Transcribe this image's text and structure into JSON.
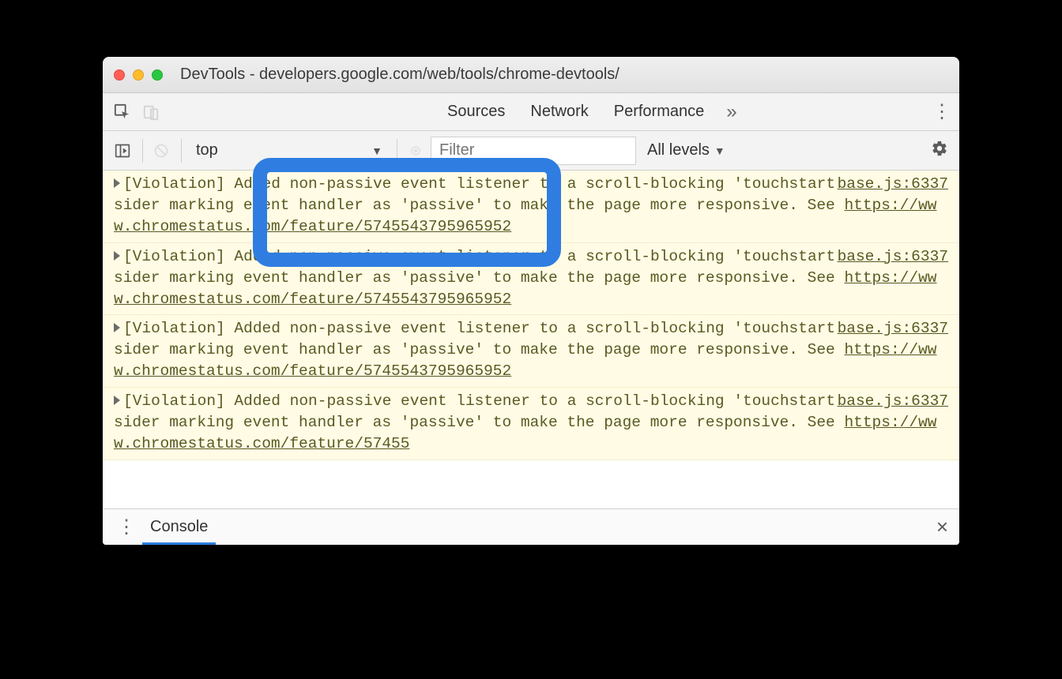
{
  "window": {
    "title": "DevTools - developers.google.com/web/tools/chrome-devtools/"
  },
  "tabs": {
    "sources": "Sources",
    "network": "Network",
    "performance": "Performance",
    "more": "»"
  },
  "subbar": {
    "context": "top",
    "filter_placeholder": "Filter",
    "levels": "All levels"
  },
  "log": {
    "source": "base.js:6337",
    "entries": [
      {
        "prefix": "[Violation] Added non-passive event listener to a scroll-blocking 'touchstart' event. Consider marking event handler as 'passive' to make the page more responsive. See ",
        "link": "https://www.chromestatus.com/feature/5745543795965952"
      },
      {
        "prefix": "[Violation] Added non-passive event listener to a scroll-blocking 'touchstart' event. Consider marking event handler as 'passive' to make the page more responsive. See ",
        "link": "https://www.chromestatus.com/feature/5745543795965952"
      },
      {
        "prefix": "[Violation] Added non-passive event listener to a scroll-blocking 'touchstart' event. Consider marking event handler as 'passive' to make the page more responsive. See ",
        "link": "https://www.chromestatus.com/feature/5745543795965952"
      },
      {
        "prefix": "[Violation] Added non-passive event listener to a scroll-blocking 'touchstart' event. Consider marking event handler as 'passive' to make the page more responsive. See ",
        "link": "https://www.chromestatus.com/feature/57455"
      }
    ]
  },
  "drawer": {
    "tab": "Console"
  }
}
